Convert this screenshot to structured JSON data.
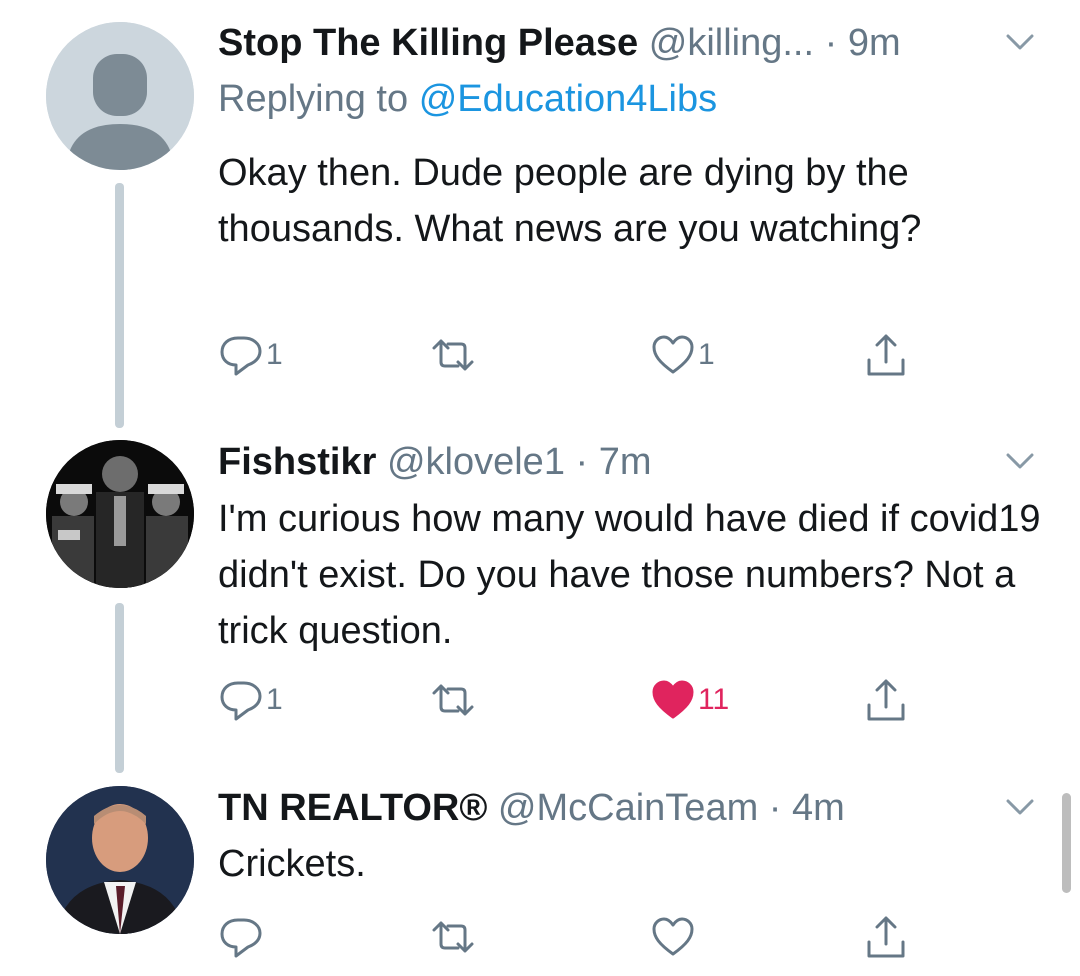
{
  "tweets": [
    {
      "name": "Stop The Killing Please",
      "handle": "@killing...",
      "time": "· 9m",
      "replying_prefix": "Replying to",
      "replying_handle": "@Education4Libs",
      "text": "Okay then. Dude people are dying by the thousands. What news are you watching?",
      "reply_count": "1",
      "like_count": "1",
      "liked": false,
      "avatar": "default-person-icon"
    },
    {
      "name": "Fishstikr",
      "handle": "@klovele1",
      "time": "· 7m",
      "text": "I'm curious how many would have died if covid19 didn't exist. Do you have those numbers? Not a trick question.",
      "reply_count": "1",
      "like_count": "11",
      "liked": true,
      "avatar": "group-photo"
    },
    {
      "name": "TN REALTOR®",
      "handle": "@McCainTeam",
      "time": "· 4m",
      "text": "Crickets.",
      "reply_count": "",
      "like_count": "",
      "liked": false,
      "avatar": "man-suit-photo"
    }
  ],
  "colors": {
    "link": "#1b95e0",
    "secondary": "#657786",
    "like_active": "#e0245e",
    "thread_line": "#c4cfd6"
  }
}
